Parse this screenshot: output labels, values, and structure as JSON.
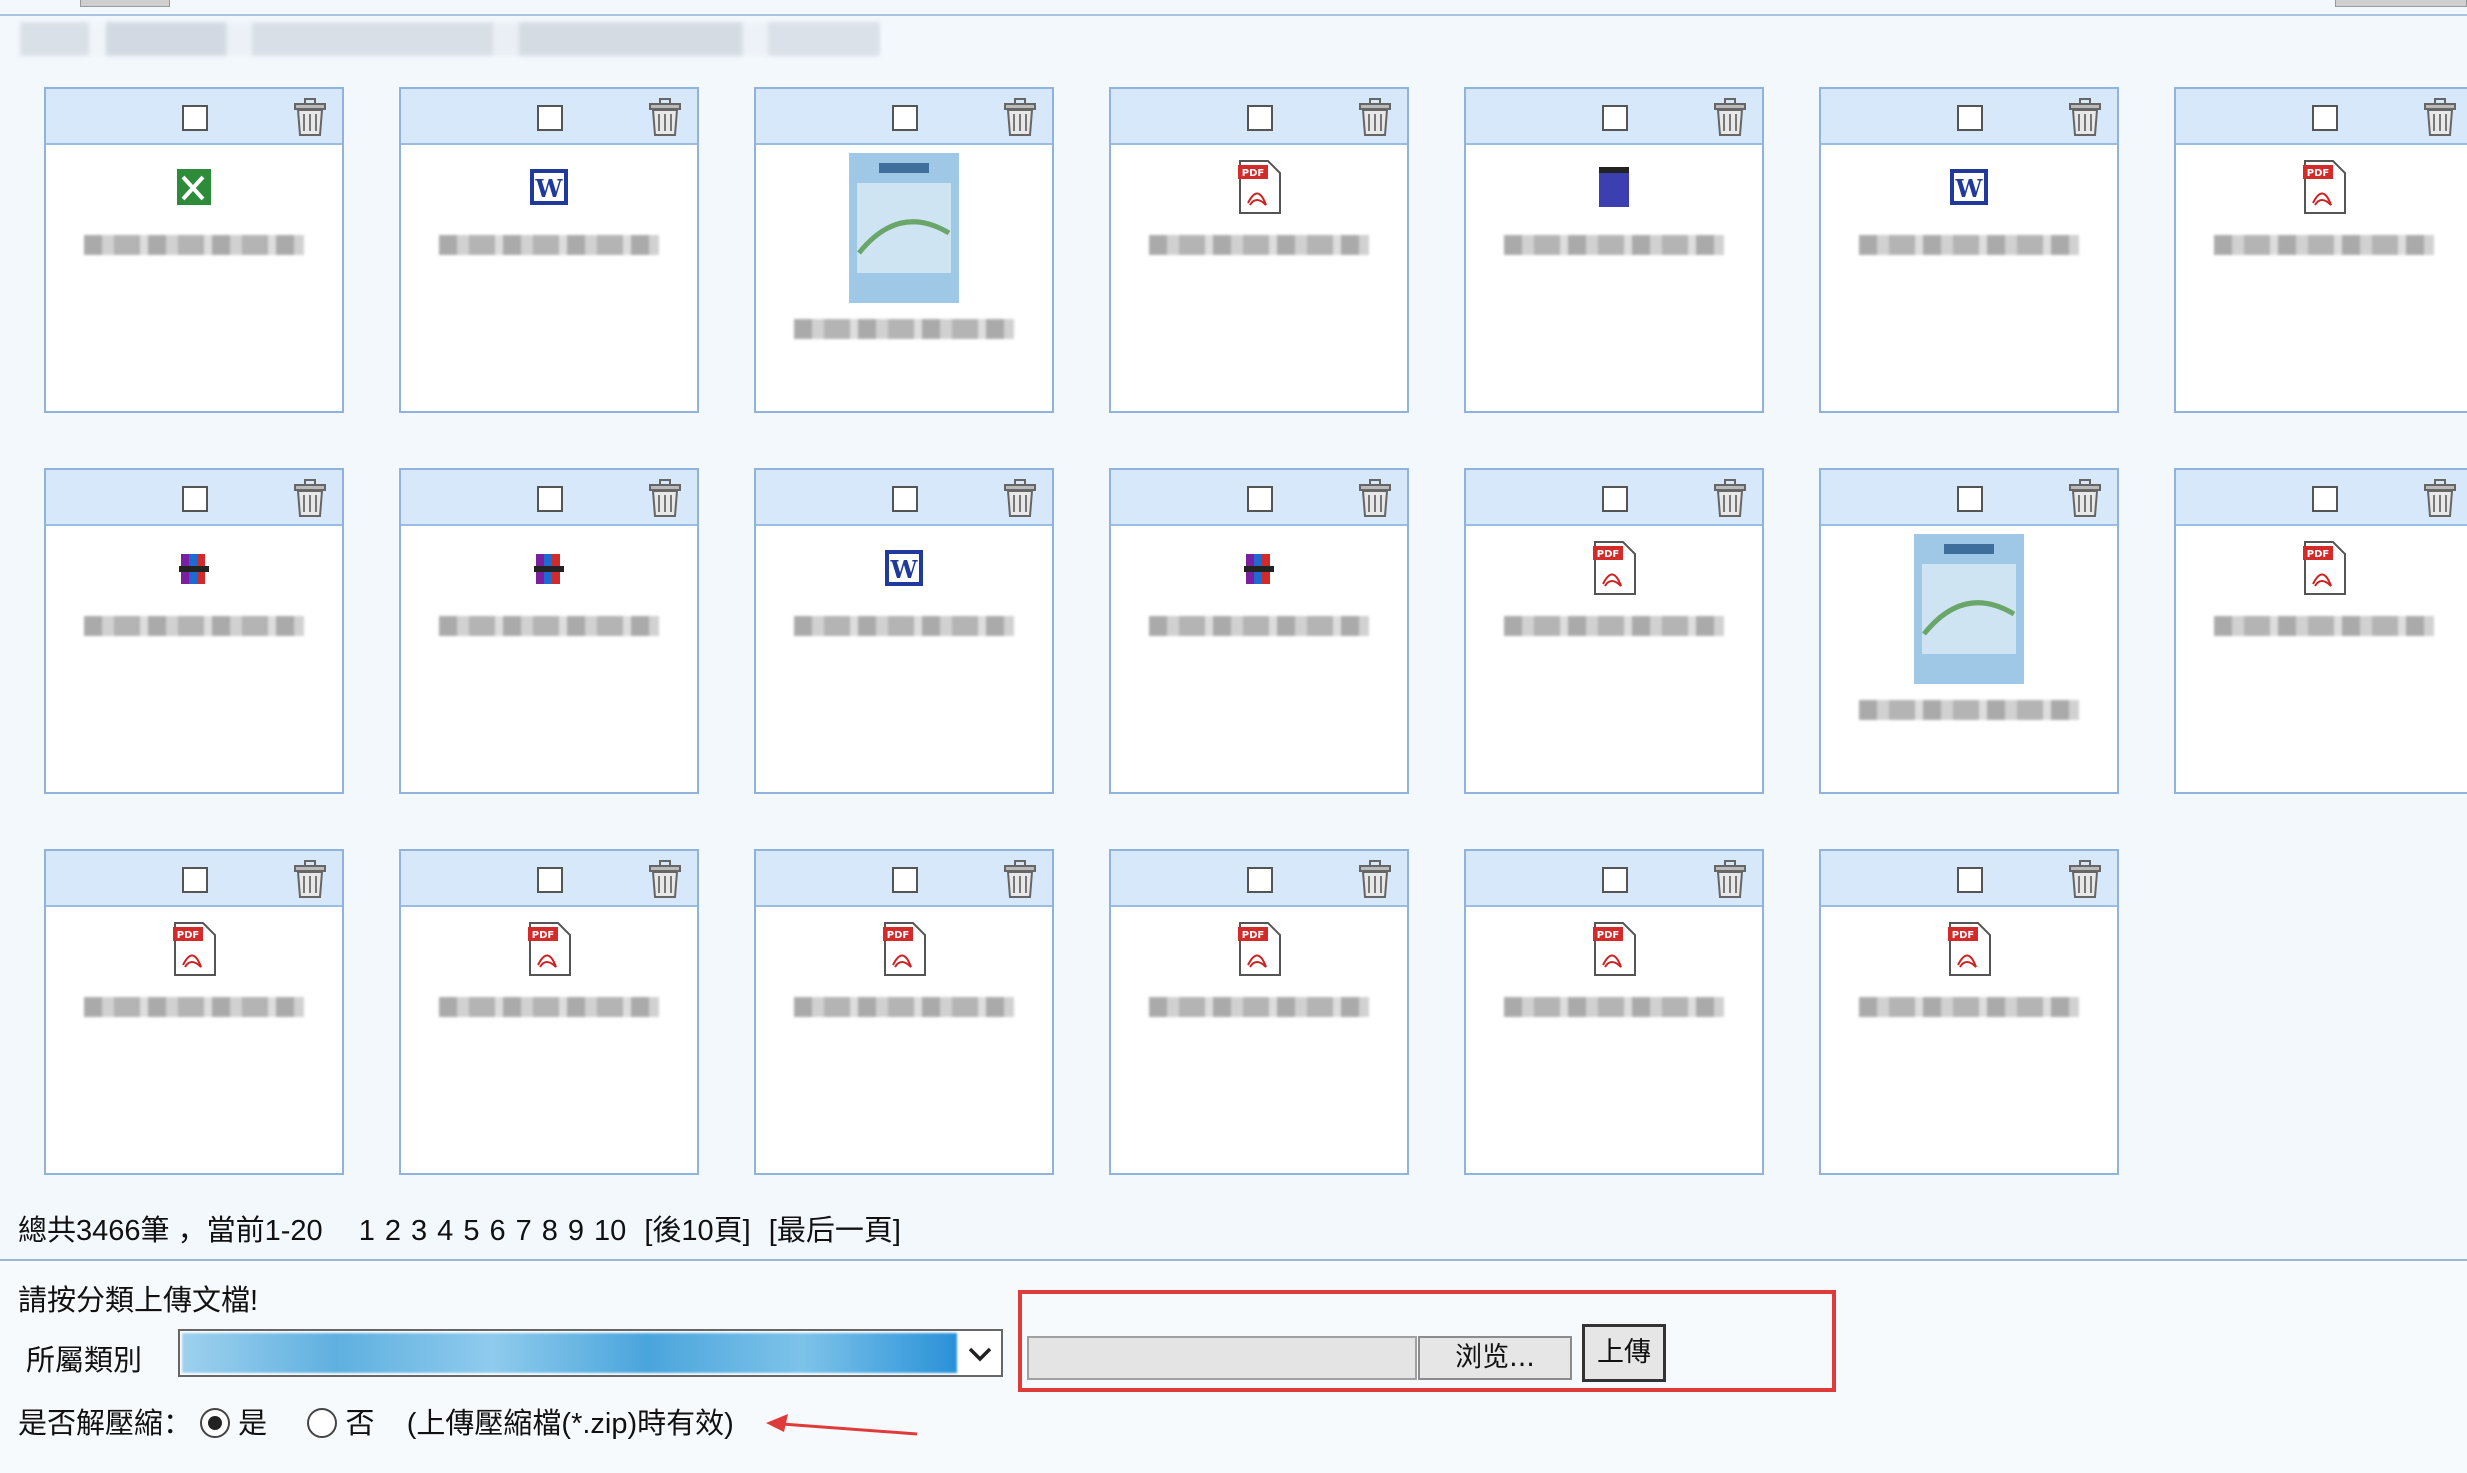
{
  "header": {
    "blurred_text": ""
  },
  "files": [
    {
      "icon": "excel-icon",
      "name": "",
      "tall": false
    },
    {
      "icon": "word-icon",
      "name": "1070412-5.doc",
      "tall": false
    },
    {
      "icon": "image-thumbnail",
      "name": "",
      "tall": true
    },
    {
      "icon": "pdf-icon",
      "name": "1070412-5.pdf",
      "tall": false
    },
    {
      "icon": "generic-file-icon",
      "name": "",
      "tall": false
    },
    {
      "icon": "word-icon",
      "name": "",
      "tall": false
    },
    {
      "icon": "pdf-icon",
      "name": "1070412-1.pdf",
      "tall": false
    },
    {
      "icon": "rar-icon",
      "name": "",
      "tall": false
    },
    {
      "icon": "rar-icon",
      "name": "",
      "tall": false
    },
    {
      "icon": "word-icon",
      "name": "",
      "tall": false
    },
    {
      "icon": "rar-icon",
      "name": "",
      "tall": false
    },
    {
      "icon": "pdf-icon",
      "name": "",
      "tall": false
    },
    {
      "icon": "image-thumbnail",
      "name": "2.jpg",
      "tall": true
    },
    {
      "icon": "pdf-icon",
      "name": ".pdf",
      "tall": false
    },
    {
      "icon": "pdf-icon",
      "name": "",
      "tall": false
    },
    {
      "icon": "pdf-icon",
      "name": "",
      "tall": false
    },
    {
      "icon": "pdf-icon",
      "name": ".pdf",
      "tall": false
    },
    {
      "icon": "pdf-icon",
      "name": "",
      "tall": false
    },
    {
      "icon": "pdf-icon",
      "name": "",
      "tall": false
    },
    {
      "icon": "pdf-icon",
      "name": "",
      "tall": false
    }
  ],
  "pager": {
    "summary": "總共3466筆 ，當前1-20",
    "pages": [
      "1",
      "2",
      "3",
      "4",
      "5",
      "6",
      "7",
      "8",
      "9",
      "10"
    ],
    "next10": "[後10頁]",
    "last": "[最后一頁]"
  },
  "upload": {
    "title": "請按分類上傳文檔!",
    "category_label": "所屬類別",
    "browse_label": "浏览...",
    "upload_label": "上傳",
    "unzip_label": "是否解壓縮：",
    "yes_label": "是",
    "no_label": "否",
    "note": "(上傳壓縮檔(*.zip)時有效)"
  },
  "colors": {
    "accent_red": "#e03b3b",
    "card_border": "#8fb3dc",
    "card_head": "#d7e8fb"
  }
}
